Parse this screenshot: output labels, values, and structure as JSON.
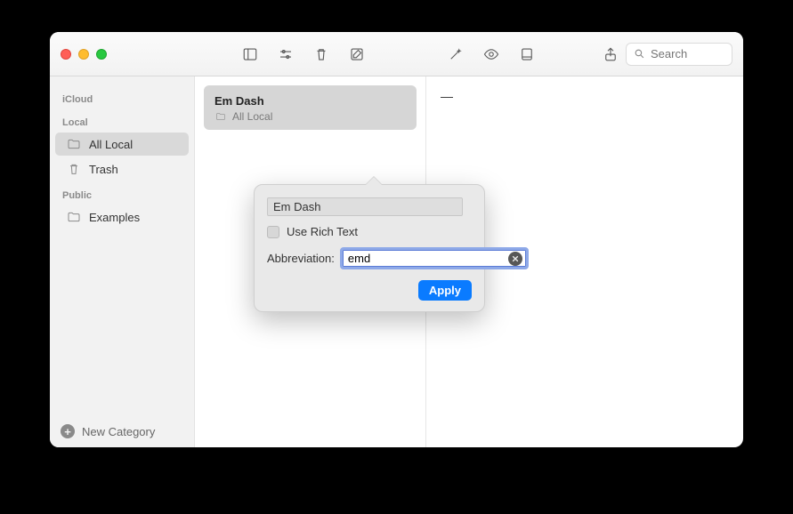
{
  "search": {
    "placeholder": "Search",
    "value": ""
  },
  "sidebar": {
    "sections": [
      {
        "header": "iCloud",
        "items": []
      },
      {
        "header": "Local",
        "items": [
          {
            "label": "All Local",
            "icon": "folder-icon",
            "selected": true
          },
          {
            "label": "Trash",
            "icon": "trash-icon",
            "selected": false
          }
        ]
      },
      {
        "header": "Public",
        "items": [
          {
            "label": "Examples",
            "icon": "folder-icon",
            "selected": false
          }
        ]
      }
    ],
    "footer": "New Category"
  },
  "list": {
    "items": [
      {
        "title": "Em Dash",
        "subtitle": "All Local"
      }
    ]
  },
  "content": {
    "text": "—"
  },
  "popover": {
    "title_value": "Em Dash",
    "rich_text_label": "Use Rich Text",
    "rich_text_checked": false,
    "abbr_label": "Abbreviation:",
    "abbr_value": "emd",
    "apply_label": "Apply"
  }
}
